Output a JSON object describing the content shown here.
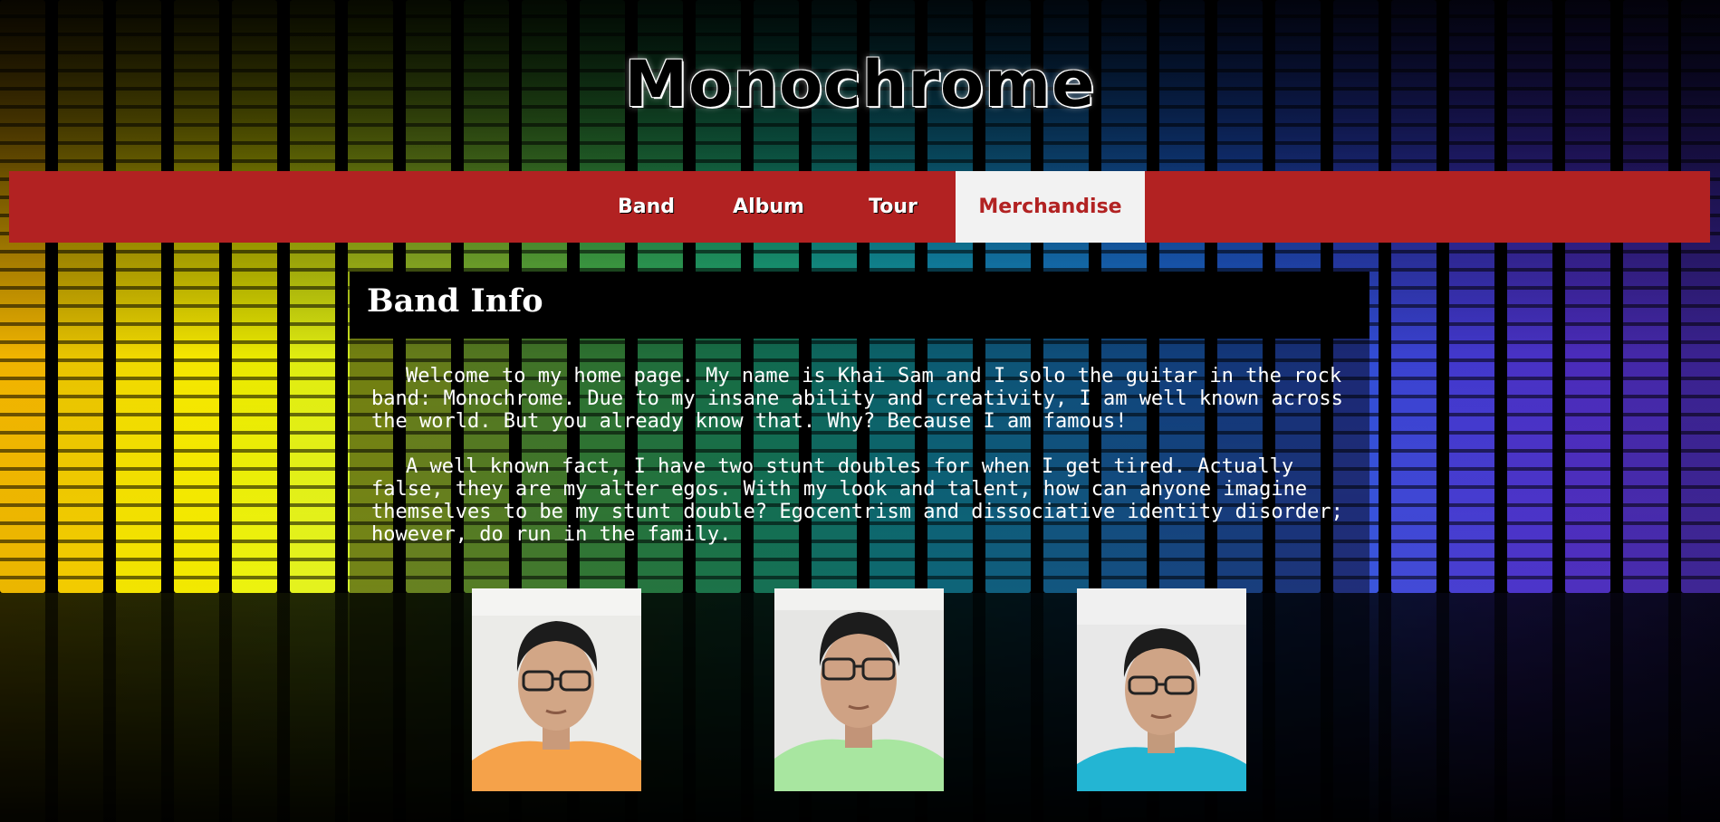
{
  "site": {
    "title": "Monochrome"
  },
  "nav": {
    "items": [
      {
        "label": "Band"
      },
      {
        "label": "Album"
      },
      {
        "label": "Tour"
      },
      {
        "label": "Merchandise",
        "active": true
      }
    ]
  },
  "main": {
    "section_title": "Band Info",
    "paragraphs": [
      "Welcome to my home page. My name is Khai Sam and I solo the guitar in the rock band: Monochrome. Due to my insane ability and creativity, I am well known across the world. But you already know that. Why? Because I am famous!",
      "A well known fact, I have two stunt doubles for when I get tired. Actually false, they are my alter egos. With my look and talent, how can anyone imagine themselves to be my stunt double? Egocentrism and dissociative identity disorder; however, do run in the family."
    ],
    "photos": [
      {
        "shirt_color": "#f5a24a"
      },
      {
        "shirt_color": "#a8e6a0"
      },
      {
        "shirt_color": "#23b5d3"
      }
    ]
  },
  "colors": {
    "nav_background": "#b22222",
    "nav_active_background": "#f2f2f2",
    "nav_active_text": "#b22222",
    "content_header_background": "#000000"
  }
}
